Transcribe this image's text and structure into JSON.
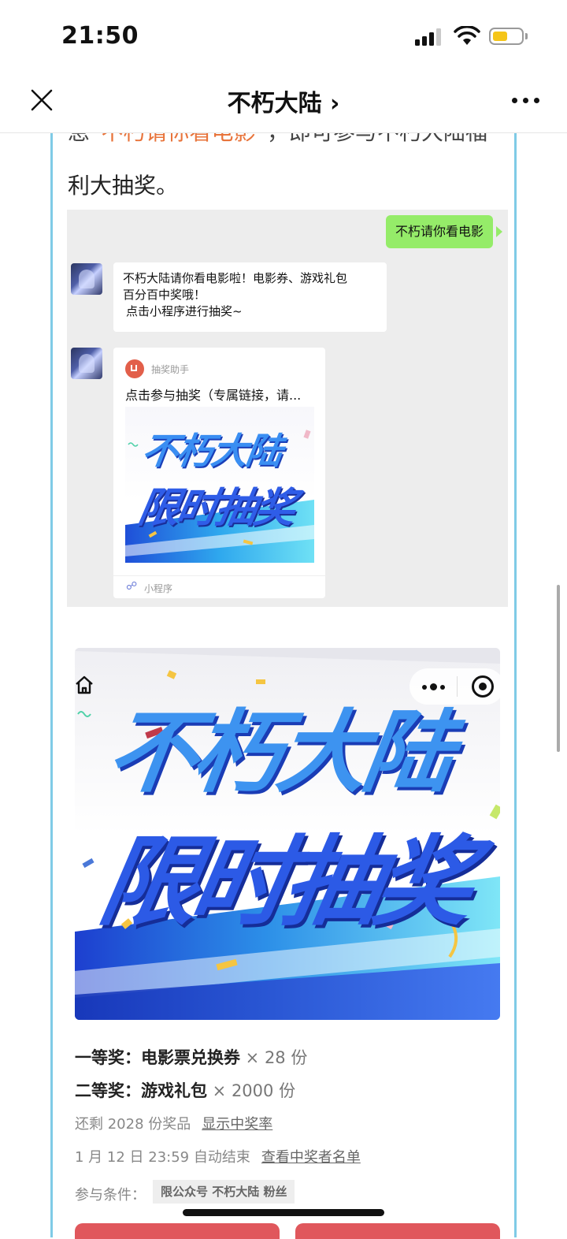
{
  "status_bar": {
    "time": "21:50"
  },
  "nav": {
    "title": "不朽大陆 ›"
  },
  "article": {
    "partial_line_prefix": "息“",
    "partial_line_keyword": "不朽请你看电影",
    "partial_line_suffix": "”，即可参与不朽大陆福",
    "line": "利大抽奖。"
  },
  "chat": {
    "user_message": "不朽请你看电影",
    "reply_lines": [
      "不朽大陆请你看电影啦！电影券、游戏礼包",
      "百分百中奖哦！",
      "点击小程序进行抽奖~"
    ],
    "mini_program": {
      "name": "抽奖助手",
      "description": "点击参与抽奖（专属链接，请...",
      "banner_line1": "不朽大陆",
      "banner_line2": "限时抽奖",
      "footer": "小程序"
    }
  },
  "lottery": {
    "banner_line1": "不朽大陆",
    "banner_line2": "限时抽奖",
    "prize1_label": "一等奖：电影票兑换券",
    "prize1_qty": " × 28 份",
    "prize2_label": "二等奖：游戏礼包",
    "prize2_qty": " × 2000 份",
    "remaining": "还剩 2028 份奖品",
    "show_rate": "显示中奖率",
    "end_time": "1 月 12 日 23:59 自动结束",
    "view_winners": "查看中奖者名单",
    "condition_label": "参与条件：",
    "condition_tag": "限公众号 不朽大陆 粉丝"
  },
  "colors": {
    "accent_orange": "#e8743b",
    "wechat_green": "#95ec69",
    "frame_blue": "#7fcbe6",
    "title_blue": "#3f7ff0"
  },
  "icons": [
    "close-icon",
    "more-icon",
    "home-icon",
    "target-icon",
    "mini-program-icon"
  ]
}
